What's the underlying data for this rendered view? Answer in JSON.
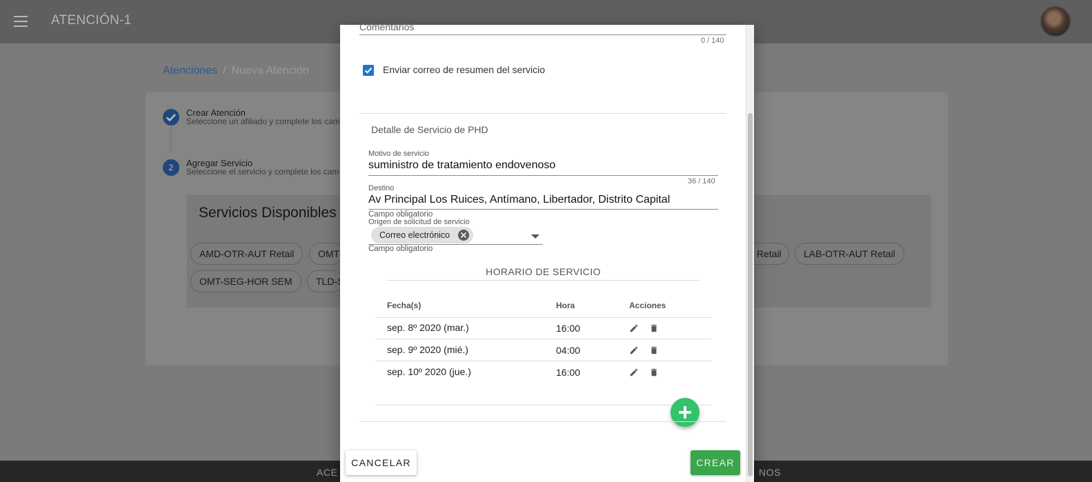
{
  "app": {
    "title": "ATENCIÓN-1"
  },
  "breadcrumb": {
    "root": "Atenciones",
    "separator": "/",
    "current": "Nueva Atención"
  },
  "steps": [
    {
      "number": "",
      "title": "Crear Atención",
      "subtitle": "Seleccione un afiliado y complete los cam",
      "status": "done"
    },
    {
      "number": "2",
      "title": "Agregar Servicio",
      "subtitle": "Seleccione el servicio y complete los cam",
      "status": "active"
    }
  ],
  "services": {
    "title": "Servicios Disponibles",
    "chips": [
      "AMD-OTR-AUT Retail",
      "OMT-",
      "Retail",
      "LAB-OTR-AUT Retail",
      "OMT-SEG-HOR SEM",
      "TLD-S"
    ]
  },
  "footer": {
    "left": "ACE",
    "right": "NOS"
  },
  "dialog": {
    "comments_label": "Comentarios",
    "comments_counter": "0 / 140",
    "email_checkbox": {
      "label": "Enviar correo de resumen del servicio",
      "checked": true
    },
    "section_title": "Detalle de Servicio de PHD",
    "motivo": {
      "label": "Motivo de servicio",
      "value": "suministro de tratamiento endovenoso",
      "counter": "36 / 140"
    },
    "destino": {
      "label": "Destino",
      "value": "Av Principal Los Ruices, Antímano, Libertador, Distrito Capital",
      "hint": "Campo obligatorio"
    },
    "origen": {
      "label": "Origen de solicitud de servicio",
      "chip": "Correo electrónico",
      "hint": "Campo obligatorio"
    },
    "schedule": {
      "title": "HORARIO DE SERVICIO",
      "columns": [
        "Fecha(s)",
        "Hora",
        "Acciones"
      ],
      "rows": [
        {
          "date": "sep. 8º 2020 (mar.)",
          "time": "16:00"
        },
        {
          "date": "sep. 9º 2020 (mié.)",
          "time": "04:00"
        },
        {
          "date": "sep. 10º 2020 (jue.)",
          "time": "16:00"
        }
      ]
    },
    "cancel_label": "CANCELAR",
    "create_label": "CREAR"
  },
  "colors": {
    "accent": "#1f77c9",
    "success": "#3aa54a",
    "fab": "#34c26a",
    "overlay_topbar": "#5f5f5f"
  },
  "icons": [
    "menu-icon",
    "check-icon",
    "edit-icon",
    "delete-icon",
    "add-icon",
    "close-icon",
    "chevron-down-icon"
  ]
}
